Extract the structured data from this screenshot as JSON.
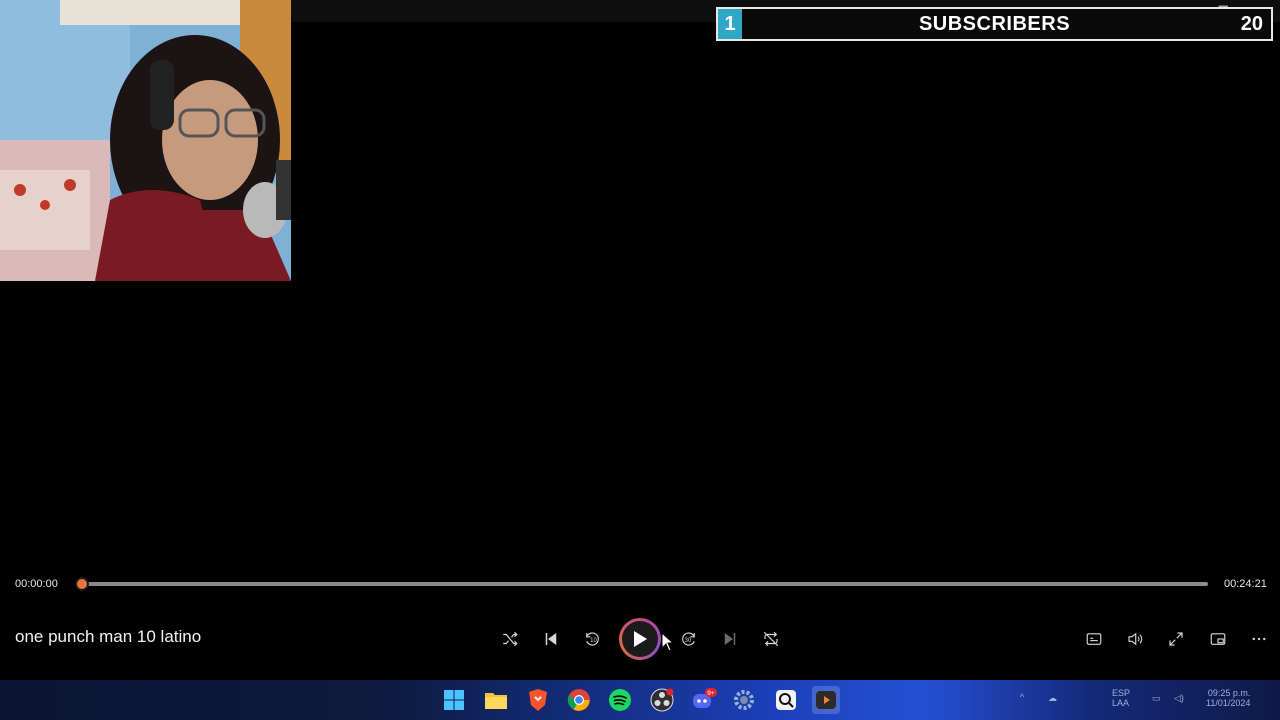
{
  "overlay": {
    "subscriber_count": "1",
    "label": "SUBSCRIBERS",
    "goal": "20"
  },
  "player": {
    "current_time": "00:00:00",
    "duration": "00:24:21",
    "progress_fraction": 0.0,
    "media_title": "one punch man 10 latino",
    "skip_back_label": "10",
    "skip_forward_label": "30",
    "accent_color": "#e9743b"
  },
  "window": {
    "minimize_glyph": "—",
    "restore_glyph": "❐",
    "close_glyph": "✕"
  },
  "taskbar": {
    "icons": [
      "windows-start-icon",
      "file-explorer-icon",
      "brave-browser-icon",
      "chrome-icon",
      "spotify-icon",
      "obs-icon",
      "discord-icon",
      "settings-icon",
      "search-app-icon",
      "media-player-icon"
    ],
    "discord_badge": "9+",
    "tray_lang_top": "ESP",
    "tray_lang_bottom": "LAA",
    "tray_time": "09:25 p.m.",
    "tray_date": "11/01/2024"
  }
}
